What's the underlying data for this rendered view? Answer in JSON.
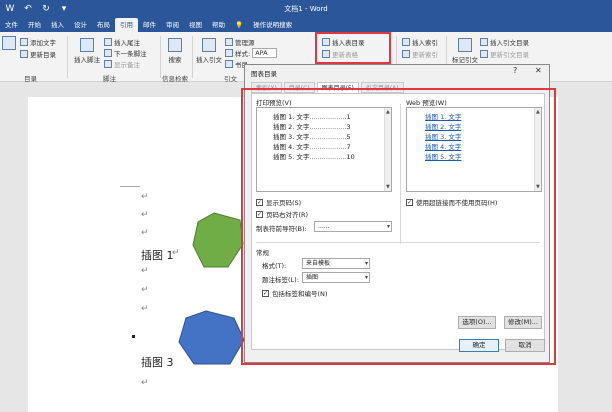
{
  "titlebar": {
    "qat": [
      "W",
      "↶",
      "↻",
      "▾"
    ],
    "title": "文档1 - Word"
  },
  "tabs": [
    "文件",
    "开始",
    "插入",
    "设计",
    "布局",
    "引用",
    "邮件",
    "审阅",
    "视图",
    "帮助",
    "💡",
    "操作说明搜索"
  ],
  "ribbon": {
    "toc_items": [
      "添加文字",
      "更新目录"
    ],
    "toc_label": "目录",
    "footnote_big": "插入脚注",
    "footnote_items": [
      "插入尾注",
      "下一条脚注",
      "显示备注"
    ],
    "footnote_label": "脚注",
    "research_big": "搜索",
    "research_label": "信息检索",
    "citation_big": "插入引文",
    "citation_items": [
      "管理源",
      "样式:",
      "APA",
      "书目"
    ],
    "citation_label": "引文",
    "caption_items": [
      "插入表目录",
      "更新表格"
    ],
    "index_items": [
      "插入索引",
      "更新索引"
    ],
    "mark_label": "标记引文",
    "toa_items": [
      "插入引文目录",
      "更新引文目录"
    ]
  },
  "document": {
    "caption1": "插图 1",
    "caption3": "插图 3",
    "para_mark": "↵"
  },
  "dialog": {
    "title": "图表目录",
    "help": "?",
    "close": "✕",
    "tabs": [
      "索引(X)",
      "目录(C)",
      "图表目录(F)",
      "引文目录(A)"
    ],
    "print_preview_label": "打印预览(V)",
    "print_rows": [
      {
        "text": "插图 1. 文字",
        "page": "1"
      },
      {
        "text": "插图 2. 文字",
        "page": "3"
      },
      {
        "text": "插图 3. 文字",
        "page": "5"
      },
      {
        "text": "插图 4. 文字",
        "page": "7"
      },
      {
        "text": "插图 5. 文字",
        "page": "10"
      }
    ],
    "web_preview_label": "Web 预览(W)",
    "web_rows": [
      "插图 1. 文字",
      "插图 2. 文字",
      "插图 3. 文字",
      "插图 4. 文字",
      "插图 5. 文字"
    ],
    "show_page_numbers": "显示页码(S)",
    "right_align": "页码右对齐(R)",
    "tab_leader_label": "制表符前导符(B):",
    "tab_leader_value": "......",
    "use_hyperlinks": "使用超链接而不使用页码(H)",
    "general_label": "常规",
    "format_label": "格式(T):",
    "format_value": "来自模板",
    "caption_label": "题注标签(L):",
    "caption_value": "插图",
    "include_label": "包括标签和编号(N)",
    "options_button": "选项(O)...",
    "modify_button": "修改(M)...",
    "ok_button": "确定",
    "cancel_button": "取消"
  }
}
